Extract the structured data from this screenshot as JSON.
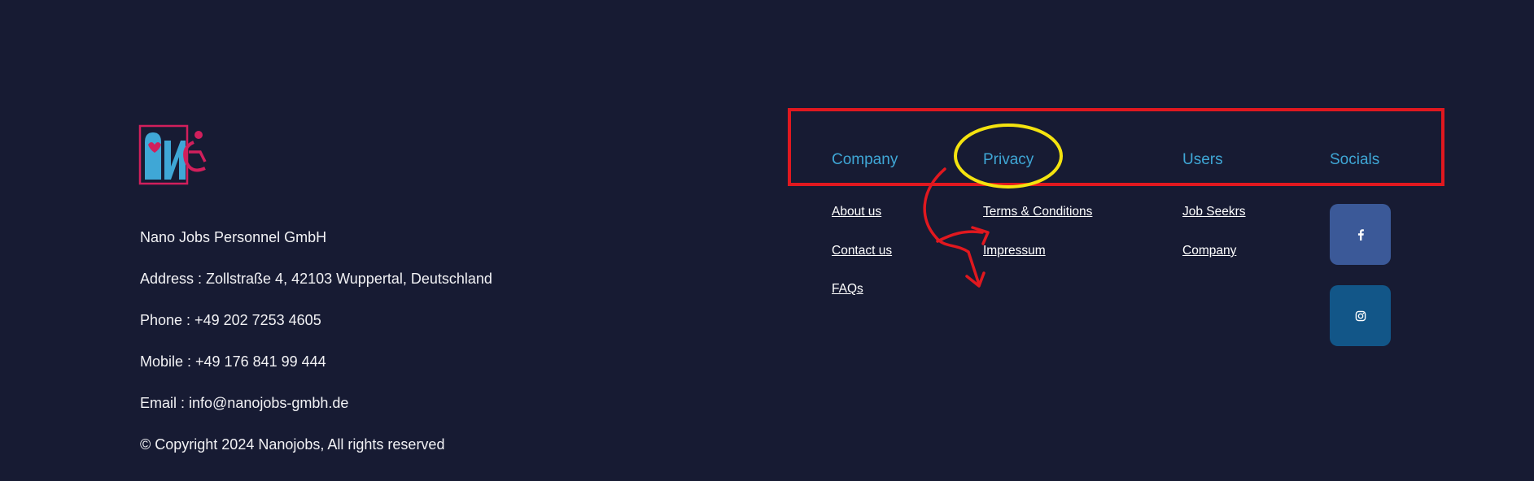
{
  "brand": {
    "logo_icon": "nano-jobs-logo",
    "accent_pink": "#d11f5c",
    "accent_blue": "#3fa7d6"
  },
  "contact": {
    "company_name": "Nano Jobs Personnel GmbH",
    "address": "Address : Zollstraße 4, 42103 Wuppertal, Deutschland",
    "phone": "Phone : +49 202 7253 4605",
    "mobile": "Mobile : +49 176 841 99 444",
    "email": "Email : info@nanojobs-gmbh.de",
    "copyright": "© Copyright 2024 Nanojobs, All rights reserved"
  },
  "columns": {
    "company": {
      "title": "Company",
      "links": [
        "About us",
        "Contact us",
        "FAQs"
      ]
    },
    "privacy": {
      "title": "Privacy",
      "links": [
        "Terms & Conditions",
        "Impressum"
      ]
    },
    "users": {
      "title": "Users",
      "links": [
        "Job Seekrs",
        "Company"
      ]
    },
    "socials": {
      "title": "Socials",
      "items": [
        {
          "icon": "facebook-icon",
          "color": "#3b5998"
        },
        {
          "icon": "instagram-icon",
          "color": "#125688"
        }
      ]
    }
  },
  "annotations": {
    "box_color": "#e0181f",
    "circle_color": "#f4e30f",
    "arrow_color": "#e0181f"
  }
}
